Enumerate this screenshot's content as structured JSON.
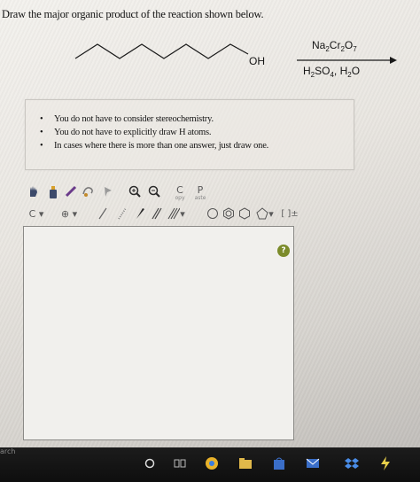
{
  "question": "Draw the major organic product of the reaction shown below.",
  "reactant_label": "OH",
  "reagents": {
    "top": {
      "na": "Na",
      "two1": "2",
      "cr": "Cr",
      "two2": "2",
      "o": "O",
      "seven": "7"
    },
    "bottom": {
      "h": "H",
      "two": "2",
      "so": "SO",
      "four": "4",
      "sep": ", H",
      "two2": "2",
      "o": "O"
    }
  },
  "instructions": [
    "You do not have to consider stereochemistry.",
    "You do not have to explicitly draw H atoms.",
    "In cases where there is more than one answer, just draw one."
  ],
  "toolbar": {
    "copy_letter": "C",
    "copy_label": "opy",
    "paste_letter": "P",
    "paste_label": "aste",
    "atom_carbon": "C",
    "dropdown": "▾",
    "bracket_label": "[ ]±"
  },
  "help_icon_label": "?",
  "taskbar_search_hint": "arch",
  "colors": {
    "help": "#7b8b2a",
    "taskbar": "#111111"
  }
}
